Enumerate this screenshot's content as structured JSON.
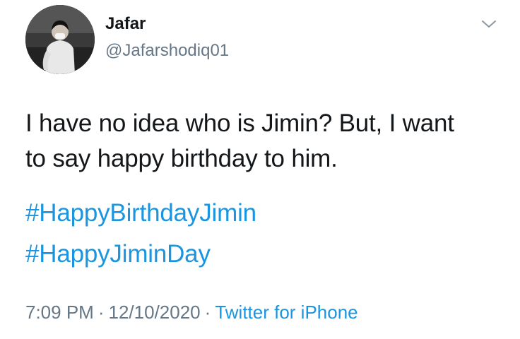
{
  "user": {
    "display_name": "Jafar",
    "handle": "@Jafarshodiq01",
    "avatar": "avatar-photo"
  },
  "tweet": {
    "text_line_1": "I have no idea who is Jimin? But, I want",
    "text_line_2": "to say happy birthday to him.",
    "hashtags": [
      "#HappyBirthdayJimin",
      "#HappyJiminDay"
    ]
  },
  "meta": {
    "time": "7:09 PM",
    "separator": "·",
    "date": "12/10/2020",
    "source": "Twitter for iPhone"
  },
  "icons": {
    "menu": "chevron-down-icon"
  },
  "colors": {
    "text": "#14171a",
    "secondary": "#657786",
    "link": "#1b95e0"
  }
}
